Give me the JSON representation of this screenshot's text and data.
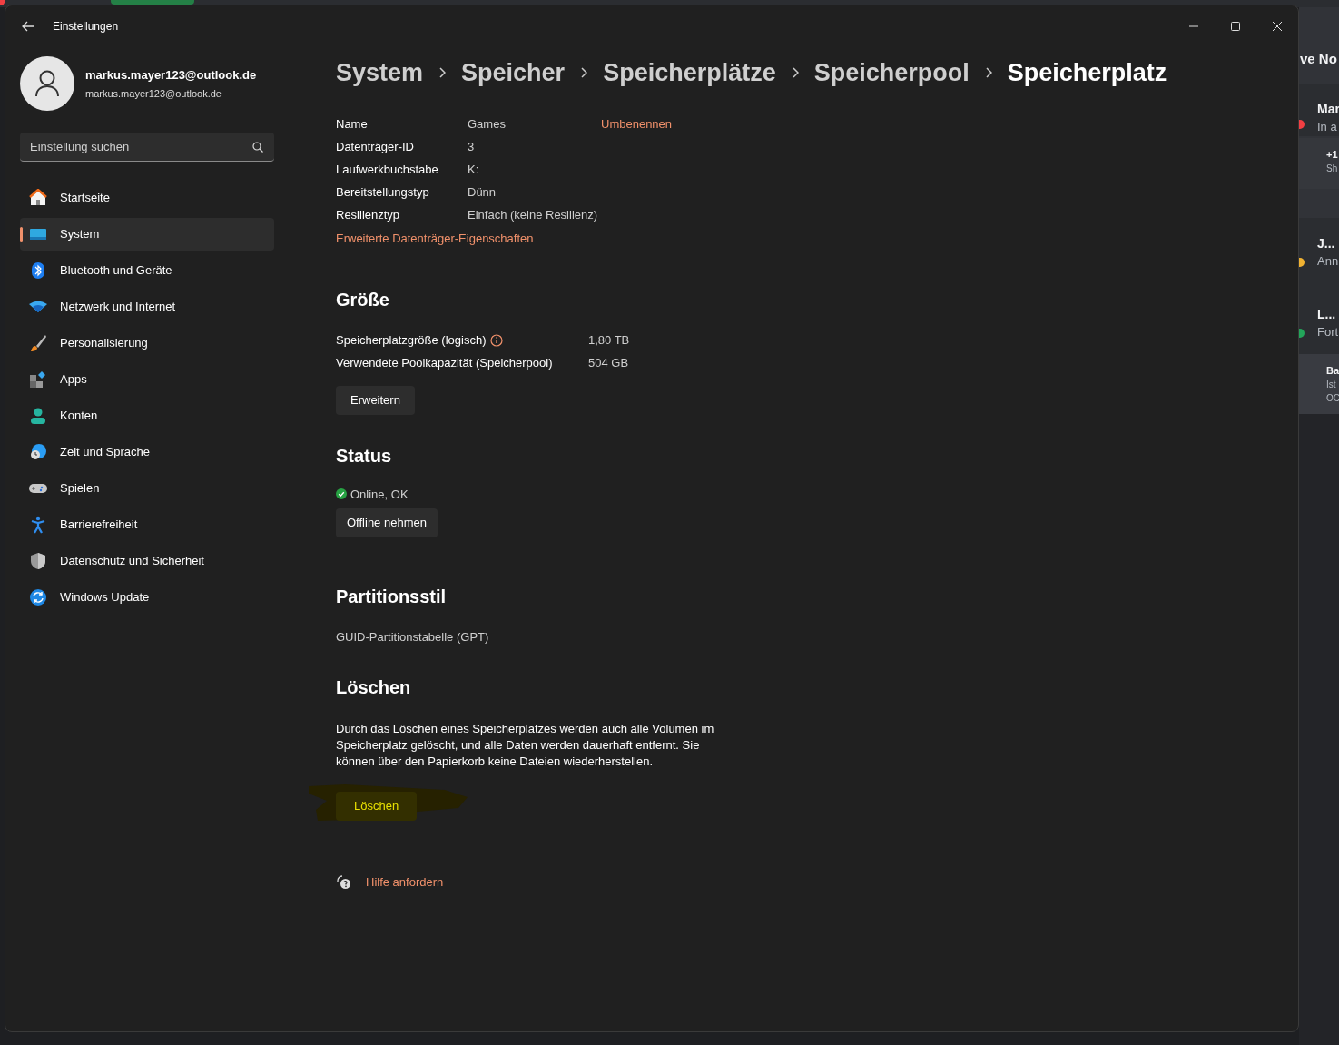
{
  "background_app": {
    "heading": "ve No",
    "entries": [
      {
        "title": "Mar",
        "lines": [
          "In a"
        ],
        "color": "#f23f43"
      },
      {
        "title": "+1",
        "lines": [
          "Sh"
        ]
      },
      {
        "title": "J...",
        "lines": [
          "Ann"
        ],
        "color": "#f0b232"
      },
      {
        "title": "L...",
        "lines": [
          "Fort"
        ],
        "color": "#23a55a"
      },
      {
        "title": "Ba",
        "lines": [
          "Ist",
          "OC"
        ]
      }
    ]
  },
  "window": {
    "title": "Einstellungen"
  },
  "user": {
    "name": "markus.mayer123@outlook.de",
    "email": "markus.mayer123@outlook.de"
  },
  "search": {
    "placeholder": "Einstellung suchen"
  },
  "nav": [
    {
      "label": "Startseite",
      "selected": false
    },
    {
      "label": "System",
      "selected": true
    },
    {
      "label": "Bluetooth und Geräte",
      "selected": false
    },
    {
      "label": "Netzwerk und Internet",
      "selected": false
    },
    {
      "label": "Personalisierung",
      "selected": false
    },
    {
      "label": "Apps",
      "selected": false
    },
    {
      "label": "Konten",
      "selected": false
    },
    {
      "label": "Zeit und Sprache",
      "selected": false
    },
    {
      "label": "Spielen",
      "selected": false
    },
    {
      "label": "Barrierefreiheit",
      "selected": false
    },
    {
      "label": "Datenschutz und Sicherheit",
      "selected": false
    },
    {
      "label": "Windows Update",
      "selected": false
    }
  ],
  "breadcrumb": [
    "System",
    "Speicher",
    "Speicherplätze",
    "Speicherpool",
    "Speicherplatz"
  ],
  "properties": [
    {
      "label": "Name",
      "value": "Games",
      "action": "Umbenennen"
    },
    {
      "label": "Datenträger-ID",
      "value": "3"
    },
    {
      "label": "Laufwerkbuchstabe",
      "value": "K:"
    },
    {
      "label": "Bereitstellungstyp",
      "value": "Dünn"
    },
    {
      "label": "Resilienztyp",
      "value": "Einfach (keine Resilienz)"
    }
  ],
  "properties_link": "Erweiterte Datenträger-Eigenschaften",
  "size": {
    "heading": "Größe",
    "rows": [
      {
        "label": "Speicherplatzgröße (logisch)",
        "value": "1,80 TB",
        "info": true
      },
      {
        "label": "Verwendete Poolkapazität (Speicherpool)",
        "value": "504 GB",
        "info": false
      }
    ],
    "button": "Erweitern"
  },
  "status": {
    "heading": "Status",
    "text": "Online, OK",
    "ok": true,
    "button": "Offline nehmen"
  },
  "partition": {
    "heading": "Partitionsstil",
    "text": "GUID-Partitionstabelle (GPT)"
  },
  "delete": {
    "heading": "Löschen",
    "description": "Durch das Löschen eines Speicherplatzes werden auch alle Volumen im Speicherplatz gelöscht, und alle Daten werden dauerhaft entfernt. Sie können über den Papierkorb keine Dateien wiederherstellen.",
    "button": "Löschen",
    "highlighted": true
  },
  "help_link": "Hilfe anfordern"
}
